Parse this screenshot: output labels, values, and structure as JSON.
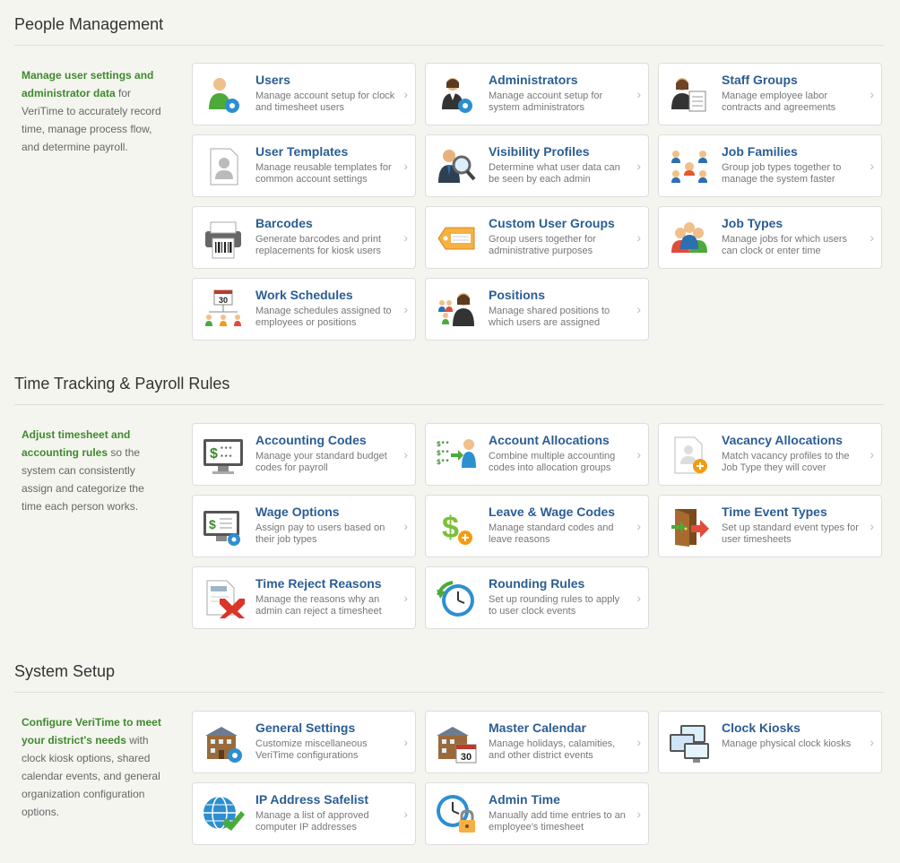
{
  "sections": [
    {
      "title": "People Management",
      "desc_highlight": "Manage user settings and administrator data",
      "desc_rest": " for VeriTime to accurately record time, manage process flow, and determine payroll.",
      "tiles": [
        {
          "title": "Users",
          "desc": "Manage account setup for clock and timesheet users",
          "icon": "user-gear-icon"
        },
        {
          "title": "Administrators",
          "desc": "Manage account setup for system administrators",
          "icon": "admin-gear-icon"
        },
        {
          "title": "Staff Groups",
          "desc": "Manage employee labor contracts and agreements",
          "icon": "staff-groups-icon"
        },
        {
          "title": "User Templates",
          "desc": "Manage reusable templates for common account settings",
          "icon": "user-template-icon"
        },
        {
          "title": "Visibility Profiles",
          "desc": "Determine what user data can be seen by each admin",
          "icon": "visibility-magnifier-icon"
        },
        {
          "title": "Job Families",
          "desc": "Group job types together to manage the system faster",
          "icon": "job-families-icon"
        },
        {
          "title": "Barcodes",
          "desc": "Generate barcodes and print replacements for kiosk users",
          "icon": "barcode-printer-icon"
        },
        {
          "title": "Custom User Groups",
          "desc": "Group users together for administrative purposes",
          "icon": "tag-icon"
        },
        {
          "title": "Job Types",
          "desc": "Manage jobs for which users can clock or enter time",
          "icon": "job-types-icon"
        },
        {
          "title": "Work Schedules",
          "desc": "Manage schedules assigned to employees or positions",
          "icon": "schedule-calendar-icon"
        },
        {
          "title": "Positions",
          "desc": "Manage shared positions to which users are assigned",
          "icon": "positions-icon"
        }
      ]
    },
    {
      "title": "Time Tracking & Payroll Rules",
      "desc_highlight": "Adjust timesheet and accounting rules",
      "desc_rest": " so the system can consistently assign and categorize the time each person works.",
      "tiles": [
        {
          "title": "Accounting Codes",
          "desc": "Manage your standard budget codes for payroll",
          "icon": "accounting-monitor-icon"
        },
        {
          "title": "Account Allocations",
          "desc": "Combine multiple accounting codes into allocation groups",
          "icon": "account-allocation-icon"
        },
        {
          "title": "Vacancy Allocations",
          "desc": "Match vacancy profiles to the Job Type they will cover",
          "icon": "vacancy-add-icon"
        },
        {
          "title": "Wage Options",
          "desc": "Assign pay to users based on their job types",
          "icon": "wage-monitor-gear-icon"
        },
        {
          "title": "Leave & Wage Codes",
          "desc": "Manage standard codes and leave reasons",
          "icon": "dollar-plus-icon"
        },
        {
          "title": "Time Event Types",
          "desc": "Set up standard event types for user timesheets",
          "icon": "door-exit-icon"
        },
        {
          "title": "Time Reject Reasons",
          "desc": "Manage the reasons why an admin can reject a timesheet",
          "icon": "reject-x-icon"
        },
        {
          "title": "Rounding Rules",
          "desc": "Set up rounding rules to apply to user clock events",
          "icon": "rounding-clock-icon"
        }
      ]
    },
    {
      "title": "System Setup",
      "desc_highlight": "Configure VeriTime to meet your district's needs",
      "desc_rest": " with clock kiosk options, shared calendar events, and general organization configuration options.",
      "tiles": [
        {
          "title": "General Settings",
          "desc": "Customize miscellaneous VeriTime configurations",
          "icon": "building-gear-icon"
        },
        {
          "title": "Master Calendar",
          "desc": "Manage holidays, calamities, and other district events",
          "icon": "building-calendar-icon"
        },
        {
          "title": "Clock Kiosks",
          "desc": "Manage physical clock kiosks",
          "icon": "kiosk-monitors-icon"
        },
        {
          "title": "IP Address Safelist",
          "desc": "Manage a list of approved computer IP addresses",
          "icon": "globe-check-icon"
        },
        {
          "title": "Admin Time",
          "desc": "Manually add time entries to an employee's timesheet",
          "icon": "clock-lock-icon"
        }
      ]
    }
  ],
  "calendar_number": "30",
  "chevron": "›",
  "colors": {
    "title": "#2b5d93",
    "highlight": "#3e8a2d"
  }
}
